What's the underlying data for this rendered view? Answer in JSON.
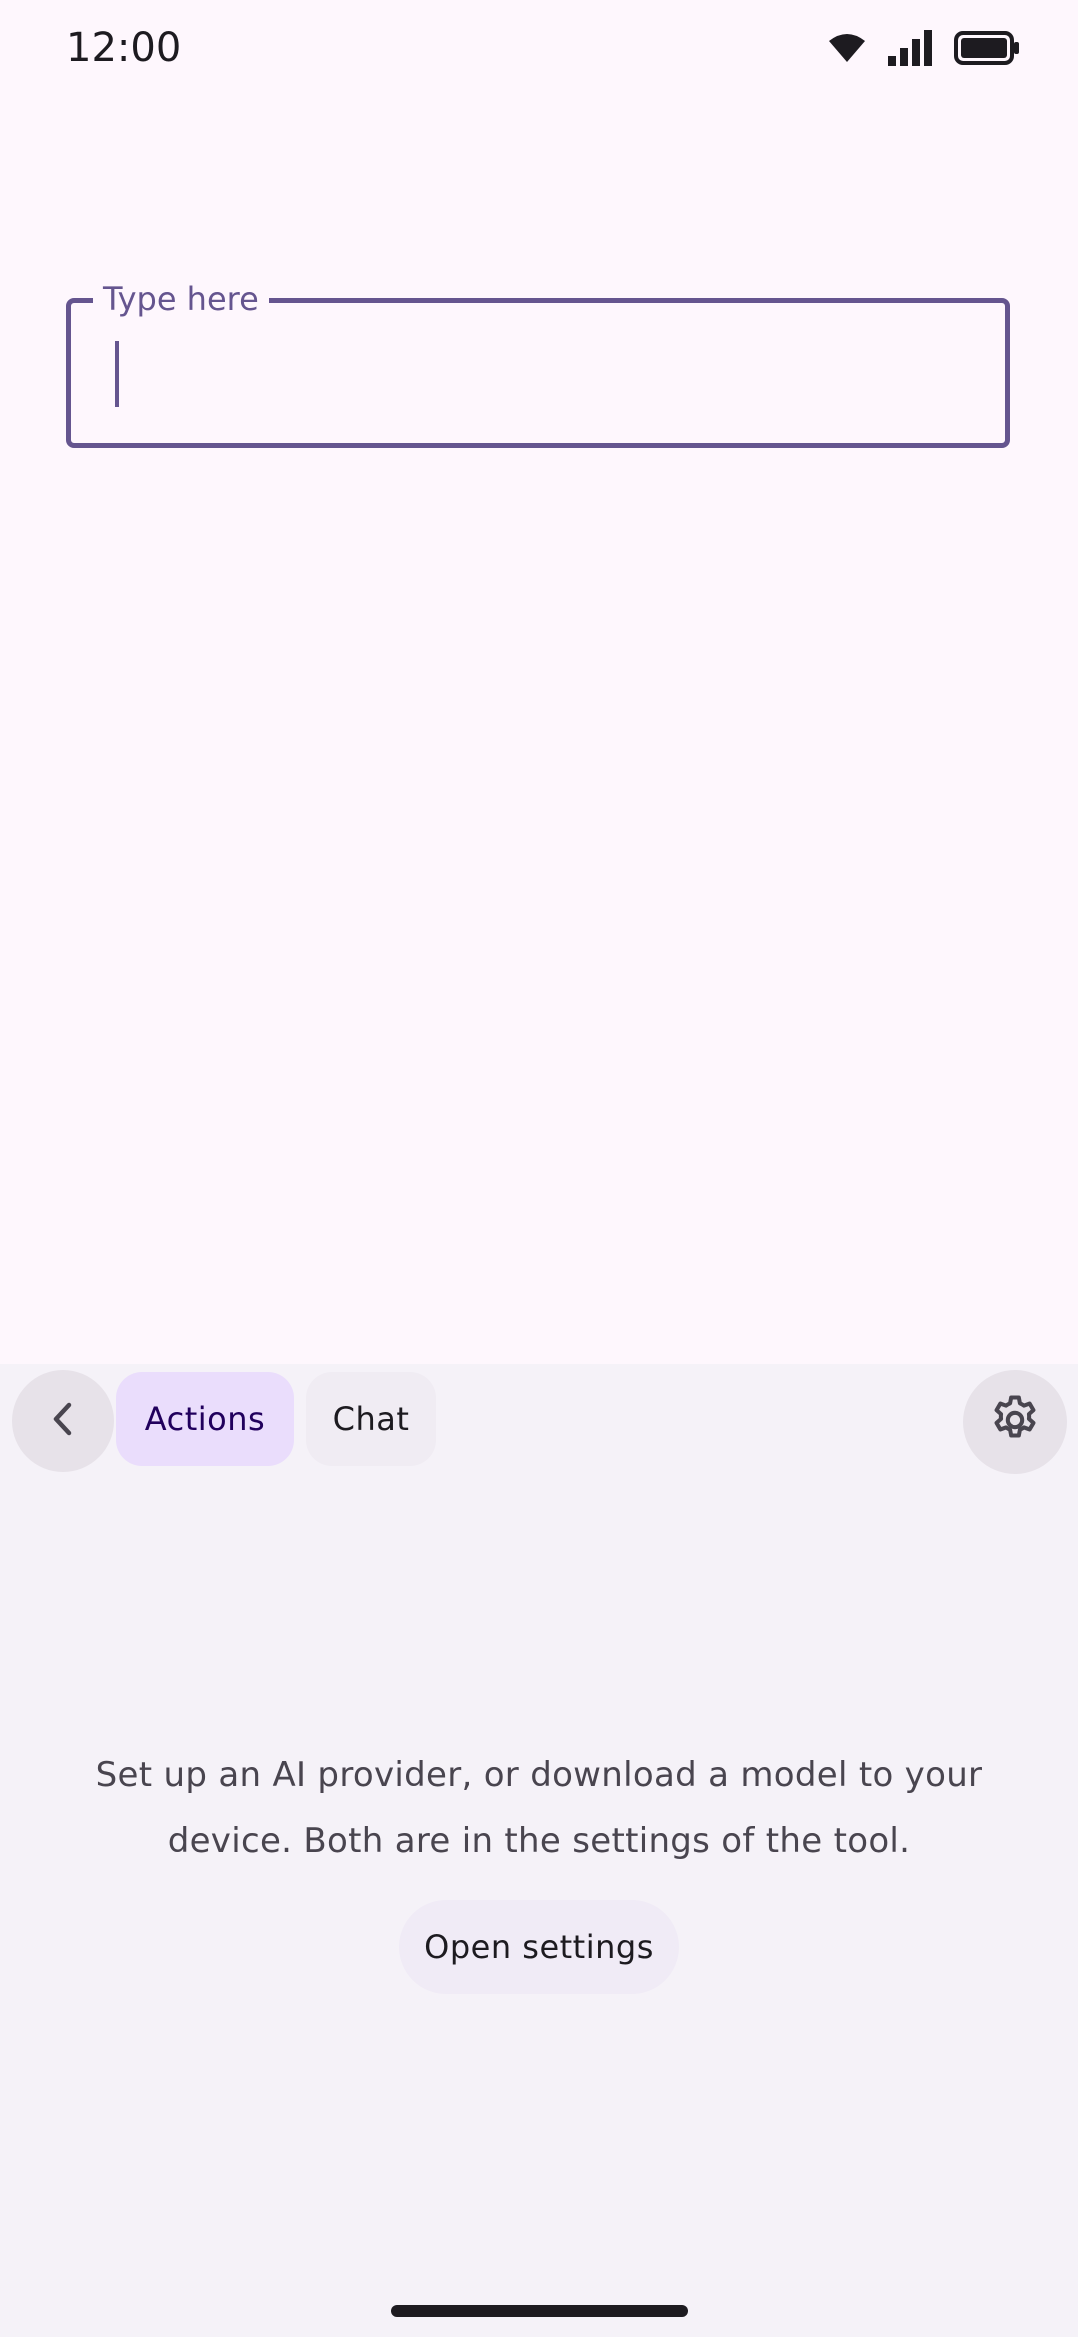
{
  "status_bar": {
    "time": "12:00",
    "icons": [
      "wifi-icon",
      "cellular-signal-icon",
      "battery-icon"
    ]
  },
  "text_field": {
    "label": "Type here",
    "value": "",
    "accent_color": "#65558f"
  },
  "panel": {
    "back_icon": "chevron-left-icon",
    "tabs": [
      {
        "label": "Actions",
        "selected": true
      },
      {
        "label": "Chat",
        "selected": false
      }
    ],
    "settings_icon": "gear-icon",
    "message": "Set up an AI provider, or download a model to your device. Both are in the settings of the tool.",
    "open_settings_label": "Open settings"
  },
  "colors": {
    "background": "#fef7fd",
    "panel_background": "#f5f2f8",
    "selected_tab": "#eaddfc",
    "selected_tab_text": "#21005d"
  }
}
